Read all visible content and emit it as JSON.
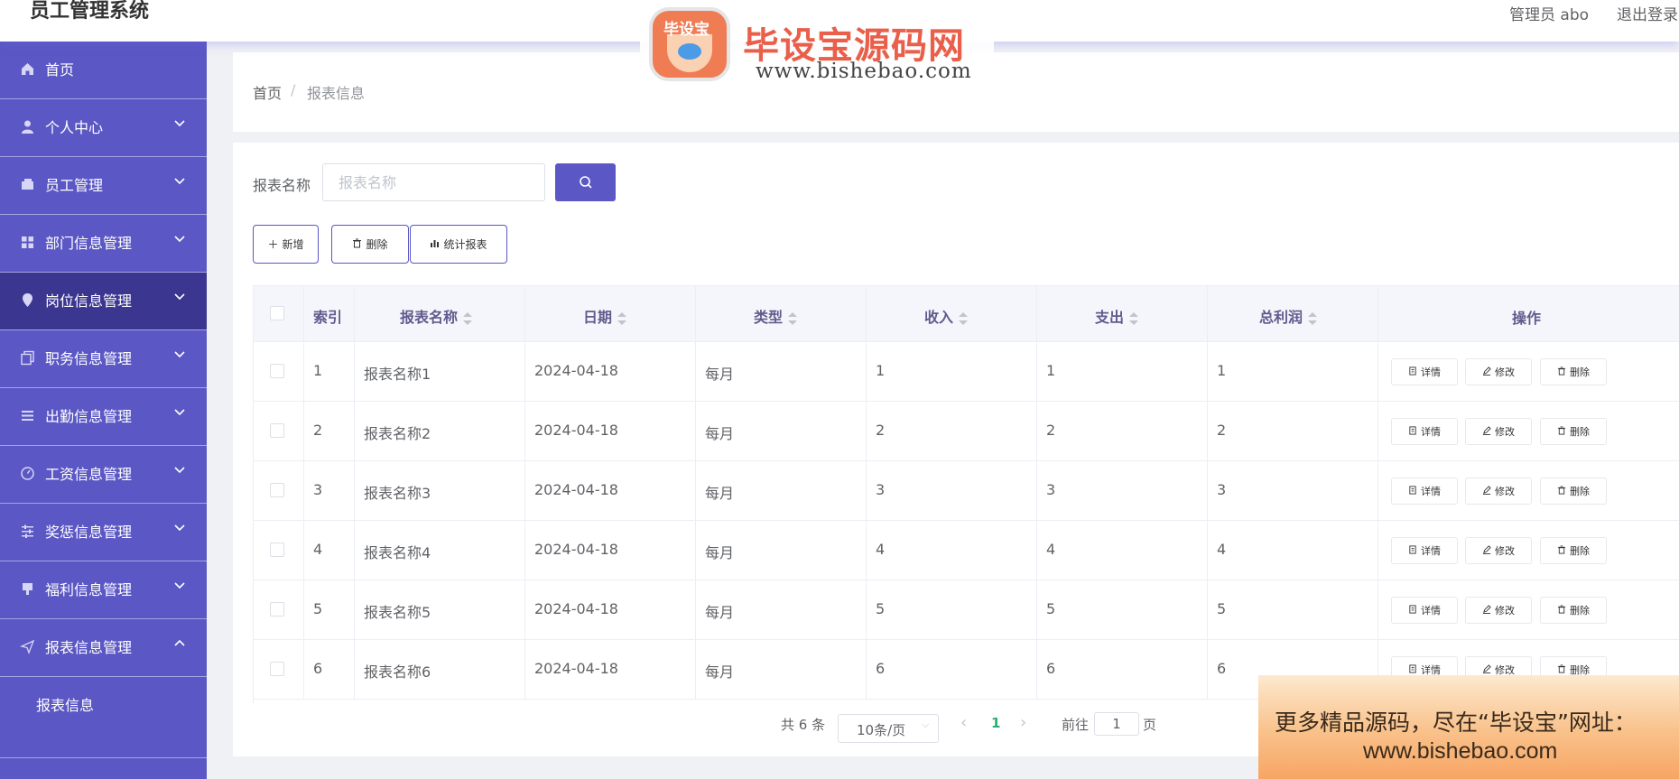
{
  "header": {
    "title": "员工管理系统",
    "user": "管理员 abo",
    "logout": "退出登录"
  },
  "watermark": {
    "badge": "毕设宝",
    "title": "毕设宝源码网",
    "url": "www.bishebao.com",
    "bottom_line1": "更多精品源码，尽在“毕设宝”网址：",
    "bottom_line2": "www.bishebao.com"
  },
  "sidebar": {
    "items": [
      {
        "label": "首页",
        "icon": "home-icon"
      },
      {
        "label": "个人中心",
        "icon": "user-icon"
      },
      {
        "label": "员工管理",
        "icon": "wallet-icon"
      },
      {
        "label": "部门信息管理",
        "icon": "grid-icon"
      },
      {
        "label": "岗位信息管理",
        "icon": "location-icon"
      },
      {
        "label": "职务信息管理",
        "icon": "copy-icon"
      },
      {
        "label": "出勤信息管理",
        "icon": "list-icon"
      },
      {
        "label": "工资信息管理",
        "icon": "dashboard-icon"
      },
      {
        "label": "奖惩信息管理",
        "icon": "sliders-icon"
      },
      {
        "label": "福利信息管理",
        "icon": "stamp-icon"
      },
      {
        "label": "报表信息管理",
        "icon": "send-icon"
      }
    ],
    "sub_item": "报表信息",
    "active_color": "#3b3690",
    "bg_color": "#5b57c4"
  },
  "breadcrumb": {
    "home": "首页",
    "separator": "/",
    "current": "报表信息"
  },
  "search": {
    "label": "报表名称",
    "placeholder": "报表名称"
  },
  "toolbar": {
    "add": "新增",
    "delete": "删除",
    "stats": "统计报表"
  },
  "table": {
    "columns": [
      "索引",
      "报表名称",
      "日期",
      "类型",
      "收入",
      "支出",
      "总利润",
      "操作"
    ],
    "rows": [
      {
        "index": "1",
        "name": "报表名称1",
        "date": "2024-04-18",
        "type": "每月",
        "income": "1",
        "expense": "1",
        "profit": "1"
      },
      {
        "index": "2",
        "name": "报表名称2",
        "date": "2024-04-18",
        "type": "每月",
        "income": "2",
        "expense": "2",
        "profit": "2"
      },
      {
        "index": "3",
        "name": "报表名称3",
        "date": "2024-04-18",
        "type": "每月",
        "income": "3",
        "expense": "3",
        "profit": "3"
      },
      {
        "index": "4",
        "name": "报表名称4",
        "date": "2024-04-18",
        "type": "每月",
        "income": "4",
        "expense": "4",
        "profit": "4"
      },
      {
        "index": "5",
        "name": "报表名称5",
        "date": "2024-04-18",
        "type": "每月",
        "income": "5",
        "expense": "5",
        "profit": "5"
      },
      {
        "index": "6",
        "name": "报表名称6",
        "date": "2024-04-18",
        "type": "每月",
        "income": "6",
        "expense": "6",
        "profit": "6"
      }
    ],
    "actions": {
      "detail": "详情",
      "edit": "修改",
      "delete": "删除"
    }
  },
  "pagination": {
    "total": "共 6 条",
    "page_size": "10条/页",
    "current_page": "1",
    "goto": "前往",
    "goto_value": "1",
    "page_unit": "页"
  }
}
